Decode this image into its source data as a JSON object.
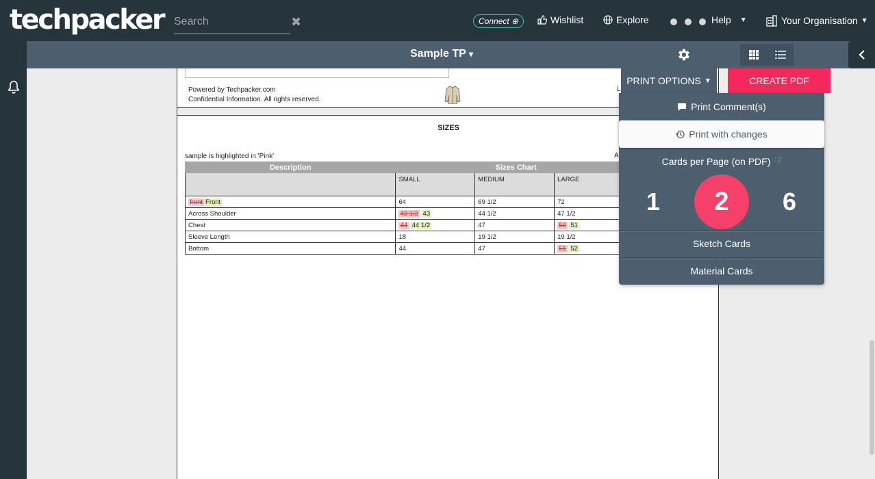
{
  "header": {
    "logo": "techpacker",
    "search_placeholder": "Search",
    "search_clear": "✖",
    "connect": "Connect",
    "wishlist": "Wishlist",
    "explore": "Explore",
    "help": "Help",
    "organisation": "Your Organisation"
  },
  "subheader": {
    "title": "Sample TP",
    "caret": "▾"
  },
  "document": {
    "footer_line1": "Powered by Techpacker.com",
    "footer_line2": "Confidential Information. All rights reserved.",
    "footer_right": "L",
    "sizes_title": "SIZES",
    "highlight_note": "sample is highlighted in 'Pink'",
    "right_note": "A",
    "table": {
      "group_description": "Description",
      "group_sizes": "Sizes Chart",
      "columns": [
        "SMALL",
        "MEDIUM",
        "LARGE"
      ],
      "rows": [
        {
          "desc_old": "front",
          "desc_new": "Front",
          "small": "64",
          "medium": "69 1/2",
          "large": "72"
        },
        {
          "desc": "Across Shoulder",
          "small_old": "42 1/2",
          "small_new": "43",
          "medium": "44 1/2",
          "large": "47 1/2"
        },
        {
          "desc": "Chest",
          "small_old": "44",
          "small_new": "44 1/2",
          "medium": "47",
          "large_old": "50",
          "large_new": "51"
        },
        {
          "desc": "Sleeve Length",
          "small": "18",
          "medium": "19 1/2",
          "large": "19 1/2"
        },
        {
          "desc": "Bottom",
          "small": "44",
          "medium": "47",
          "large_old": "51",
          "large_new": "52"
        }
      ]
    }
  },
  "print_menu": {
    "print_options": "PRINT OPTIONS",
    "create_pdf": "CREATE PDF",
    "print_comments": "Print Comment(s)",
    "print_with_changes": "Print with changes",
    "cards_per_page": "Cards per Page (on PDF)",
    "cards_per_page_value": ": 2",
    "options": [
      "1",
      "2",
      "6"
    ],
    "selected": "2",
    "sketch_cards": "Sketch Cards",
    "material_cards": "Material Cards"
  },
  "colors": {
    "topbar": "#26343c",
    "subheader": "#4d5e6e",
    "accent": "#f5285c",
    "connect_border": "#35c6b5"
  }
}
